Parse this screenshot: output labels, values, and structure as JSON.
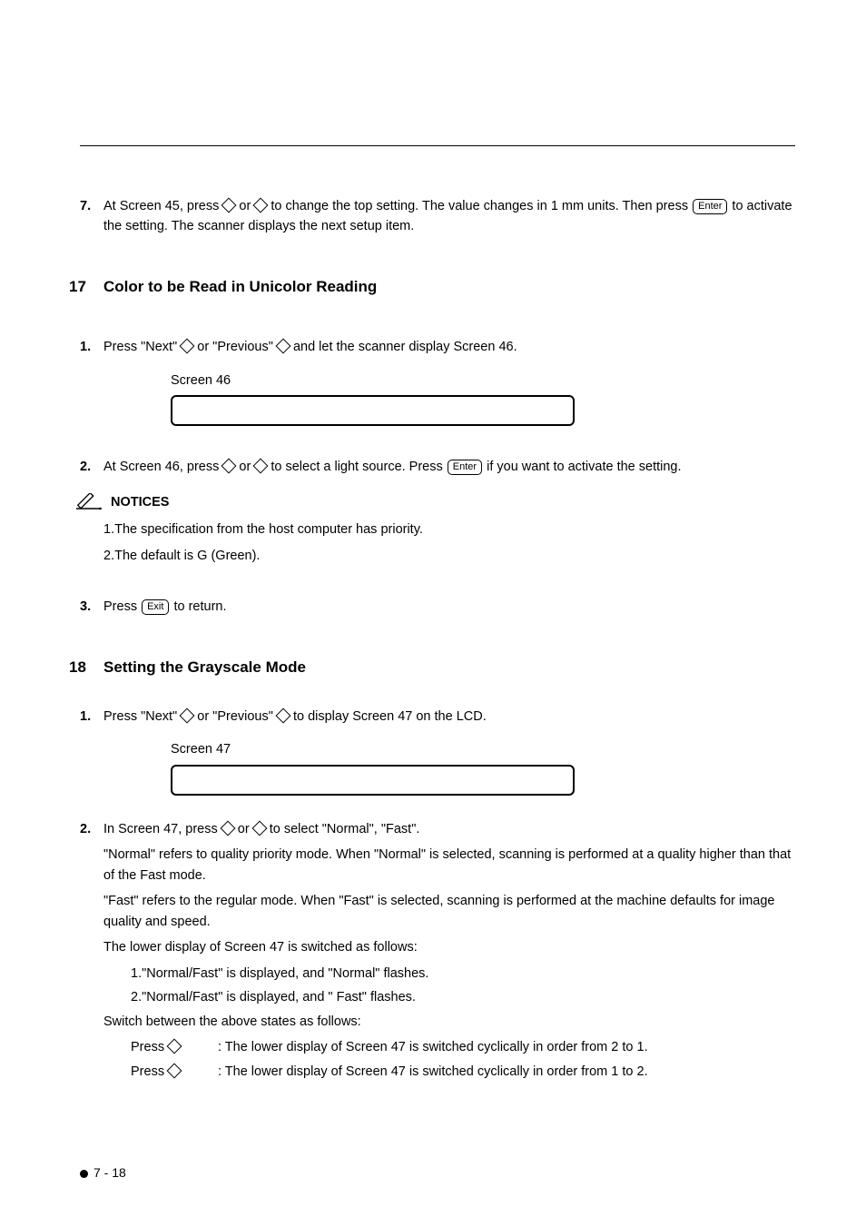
{
  "step7": {
    "num": "7.",
    "text_a": "At Screen 45, press ",
    "text_b": " or ",
    "text_c": " to change the top setting. The value changes in 1 mm units. Then press ",
    "key": "Enter",
    "text_d": " to activate the setting. The scanner displays the next setup item."
  },
  "section17": {
    "num": "17",
    "title": "Color to be Read in Unicolor Reading"
  },
  "s17_step1": {
    "num": "1.",
    "a": "Press \"Next\" ",
    "b": " or \"Previous\" ",
    "c": " and let the scanner display Screen 46.",
    "screen_label": "Screen 46"
  },
  "s17_step2": {
    "num": "2.",
    "a": "At Screen 46, press ",
    "b": " or ",
    "c": " to select a light source. Press ",
    "key": "Enter",
    "d": " if you want to activate the setting."
  },
  "notices_label": "NOTICES",
  "notice1": "1.The specification from the host computer has priority.",
  "notice2": "2.The default is G (Green).",
  "s17_step3": {
    "num": "3.",
    "a": "Press ",
    "key": "Exit",
    "b": " to return."
  },
  "section18": {
    "num": "18",
    "title": "Setting the Grayscale Mode"
  },
  "s18_step1": {
    "num": "1.",
    "a": "Press \"Next\" ",
    "b": " or \"Previous\" ",
    "c": " to display Screen 47 on the LCD.",
    "screen_label": "Screen 47"
  },
  "s18_step2": {
    "num": "2.",
    "a": "In Screen 47, press ",
    "b": " or ",
    "c": " to select \"Normal\", \"Fast\".",
    "p1": "\"Normal\" refers to quality priority mode. When \"Normal\" is selected, scanning is performed at a quality higher than that of the Fast mode.",
    "p2": "\"Fast\" refers to the regular mode. When \"Fast\" is selected, scanning is performed at the machine defaults for image quality and speed.",
    "p3": "The lower display of Screen 47 is switched as follows:",
    "li1": "1.\"Normal/Fast\" is displayed, and \"Normal\" flashes.",
    "li2": "2.\"Normal/Fast\" is displayed, and \" Fast\" flashes.",
    "p4": "Switch between the above states as follows:",
    "press_label": "Press ",
    "press1": ": The lower display of Screen 47 is switched cyclically in order from 2 to 1.",
    "press2": ": The lower display of Screen 47 is switched cyclically in order from 1 to 2."
  },
  "footer": "7 - 18"
}
